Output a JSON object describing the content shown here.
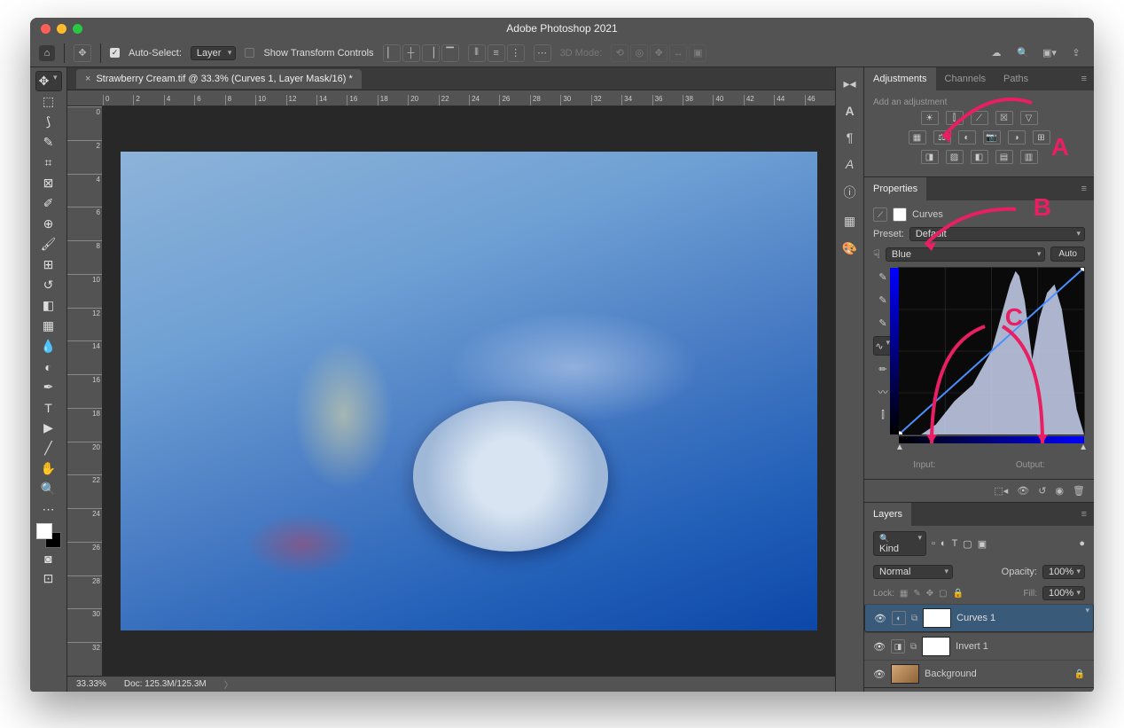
{
  "window": {
    "title": "Adobe Photoshop 2021"
  },
  "optionsBar": {
    "autoSelectLabel": "Auto-Select:",
    "autoSelectTarget": "Layer",
    "showTransformLabel": "Show Transform Controls",
    "modeLabel": "3D Mode:"
  },
  "document": {
    "tabLabel": "Strawberry Cream.tif @ 33.3% (Curves 1, Layer Mask/16) *",
    "zoom": "33.33%",
    "docSize": "Doc: 125.3M/125.3M"
  },
  "rulerH": [
    "0",
    "2",
    "4",
    "6",
    "8",
    "10",
    "12",
    "14",
    "16",
    "18",
    "20",
    "22",
    "24",
    "26",
    "28",
    "30",
    "32",
    "34",
    "36",
    "38",
    "40",
    "42",
    "44",
    "46"
  ],
  "rulerV": [
    "0",
    "2",
    "4",
    "6",
    "8",
    "10",
    "12",
    "14",
    "16",
    "18",
    "20",
    "22",
    "24",
    "26",
    "28",
    "30",
    "32"
  ],
  "panels": {
    "adjustments": {
      "tabs": [
        "Adjustments",
        "Channels",
        "Paths"
      ],
      "heading": "Add an adjustment"
    },
    "properties": {
      "tab": "Properties",
      "type": "Curves",
      "presetLabel": "Preset:",
      "presetValue": "Default",
      "channelValue": "Blue",
      "autoLabel": "Auto",
      "inputLabel": "Input:",
      "outputLabel": "Output:"
    },
    "layers": {
      "tab": "Layers",
      "kindLabel": "Kind",
      "blendMode": "Normal",
      "opacityLabel": "Opacity:",
      "opacityValue": "100%",
      "lockLabel": "Lock:",
      "fillLabel": "Fill:",
      "fillValue": "100%",
      "items": [
        {
          "name": "Curves 1"
        },
        {
          "name": "Invert 1"
        },
        {
          "name": "Background"
        }
      ]
    }
  },
  "annotations": {
    "a": "A",
    "b": "B",
    "c": "C"
  }
}
